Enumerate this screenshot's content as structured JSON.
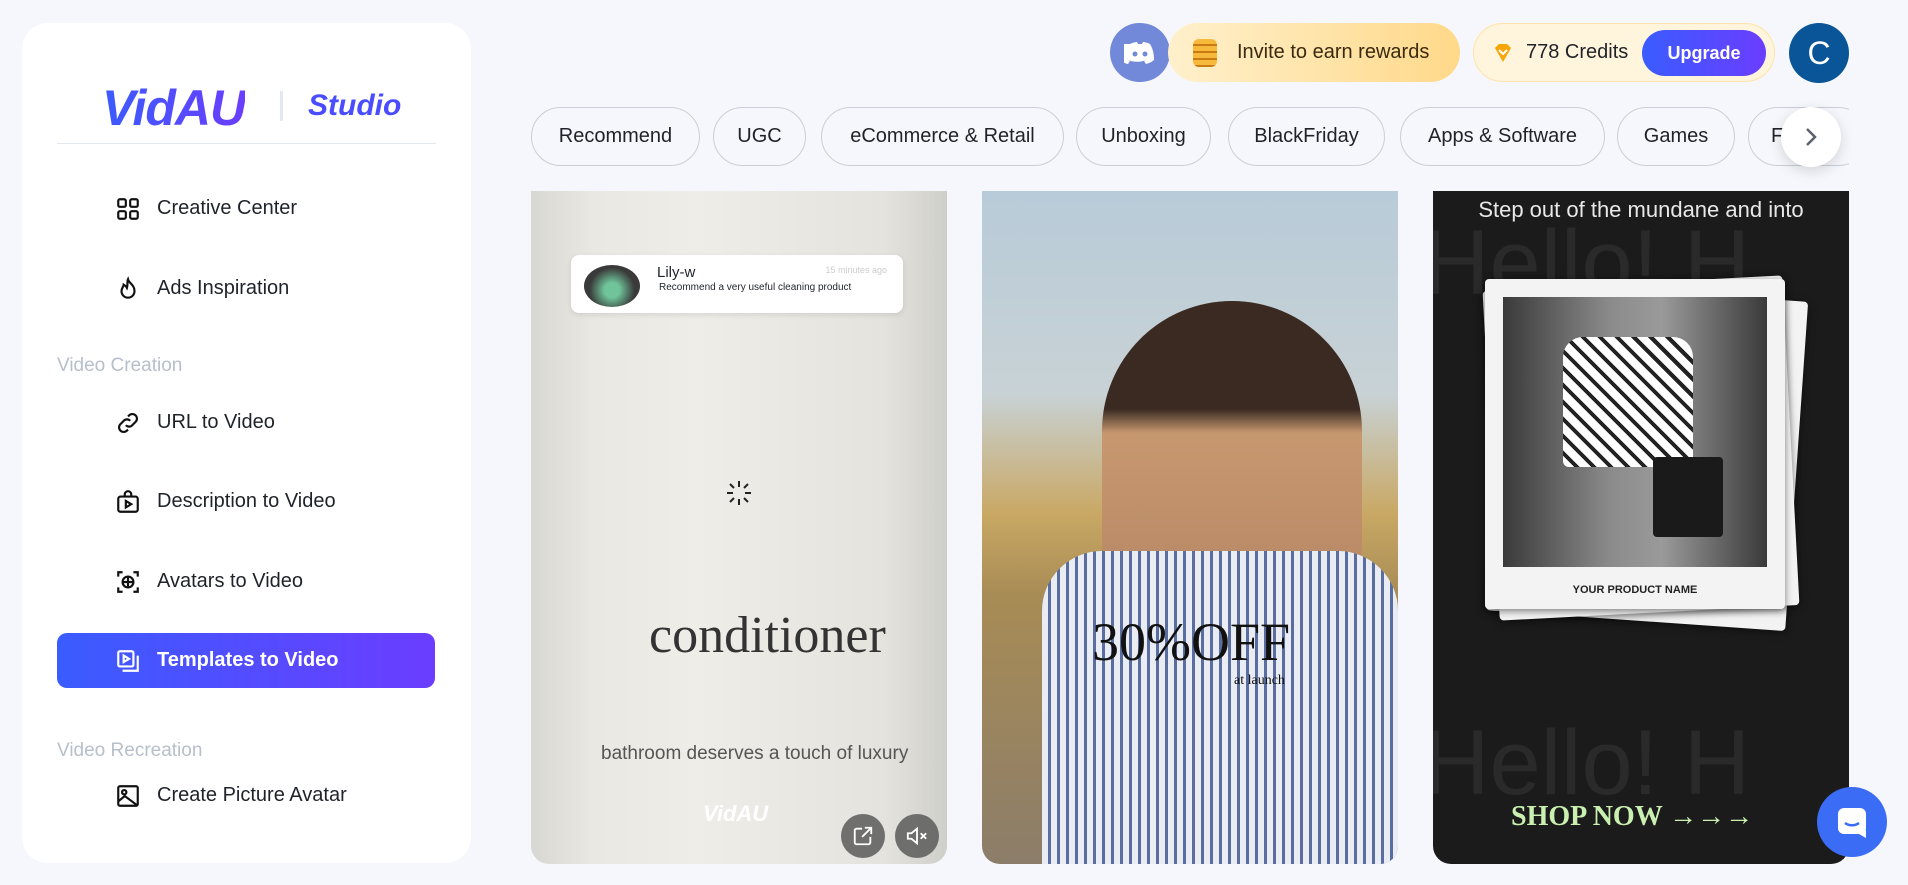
{
  "brand": {
    "logo": "VidAU",
    "product": "Studio"
  },
  "sidebar": {
    "items": [
      {
        "label": "Creative Center",
        "icon": "grid-icon"
      },
      {
        "label": "Ads Inspiration",
        "icon": "flame-icon"
      }
    ],
    "sections": [
      {
        "title": "Video Creation",
        "items": [
          {
            "label": "URL to Video",
            "icon": "link-icon"
          },
          {
            "label": "Description to Video",
            "icon": "bag-play-icon"
          },
          {
            "label": "Avatars to Video",
            "icon": "avatar-scan-icon"
          },
          {
            "label": "Templates to Video",
            "icon": "template-icon",
            "active": true
          }
        ]
      },
      {
        "title": "Video Recreation",
        "items": [
          {
            "label": "Create Picture Avatar",
            "icon": "image-icon"
          }
        ]
      }
    ]
  },
  "header": {
    "invite": "Invite to earn rewards",
    "credits": "778 Credits",
    "upgrade": "Upgrade",
    "avatar_initial": "C"
  },
  "categories": [
    "Recommend",
    "UGC",
    "eCommerce & Retail",
    "Unboxing",
    "BlackFriday",
    "Apps & Software",
    "Games",
    "Fi"
  ],
  "cards": [
    {
      "notif_name": "Lily-w",
      "notif_time": "15 minutes ago",
      "notif_msg": "Recommend a very useful cleaning product",
      "headline": "conditioner",
      "caption": "bathroom deserves a touch of luxury",
      "watermark": "VidAU"
    },
    {
      "headline": "30%OFF",
      "sub": "at launch"
    },
    {
      "top": "Step out of the mundane and into",
      "bg_text": "Hello! H",
      "product": "YOUR PRODUCT NAME",
      "cta": "SHOP NOW →→→"
    }
  ],
  "colors": {
    "accent_start": "#3a5cff",
    "accent_end": "#6b3dff",
    "discord": "#7289da",
    "avatar": "#0a5597"
  }
}
